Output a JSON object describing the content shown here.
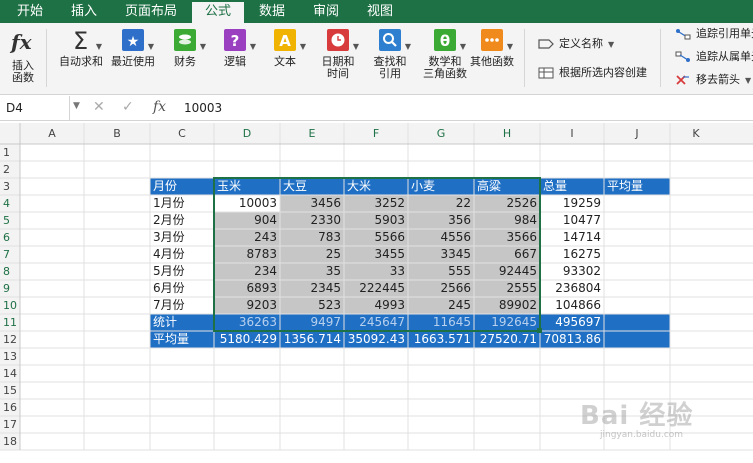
{
  "tabs": [
    {
      "label": "开始",
      "active": false
    },
    {
      "label": "插入",
      "active": false
    },
    {
      "label": "页面布局",
      "active": false
    },
    {
      "label": "公式",
      "active": true
    },
    {
      "label": "数据",
      "active": false
    },
    {
      "label": "审阅",
      "active": false
    },
    {
      "label": "视图",
      "active": false
    }
  ],
  "ribbon": {
    "insert_function": {
      "icon": "fx-icon",
      "label": "插入\n函数"
    },
    "buttons": [
      {
        "key": "autosum",
        "label": "自动求和",
        "icon": "sigma-icon",
        "color": "#333333"
      },
      {
        "key": "recent",
        "label": "最近使用",
        "icon": "star-icon",
        "color": "#2e6fc9"
      },
      {
        "key": "financial",
        "label": "财务",
        "icon": "coins-icon",
        "color": "#3aaa35"
      },
      {
        "key": "logical",
        "label": "逻辑",
        "icon": "question-icon",
        "color": "#9b3fc1"
      },
      {
        "key": "text",
        "label": "文本",
        "icon": "text-a-icon",
        "color": "#f0b400"
      },
      {
        "key": "datetime",
        "label": "日期和\n时间",
        "icon": "clock-icon",
        "color": "#d83b3b"
      },
      {
        "key": "lookup",
        "label": "查找和\n引用",
        "icon": "magnifier-icon",
        "color": "#2e7fd0"
      },
      {
        "key": "math",
        "label": "数学和\n三角函数",
        "icon": "theta-icon",
        "color": "#3aaa35"
      },
      {
        "key": "more",
        "label": "其他函数",
        "icon": "dots-icon",
        "color": "#f08a1c"
      }
    ],
    "names": {
      "define_name": "定义名称",
      "create_from_selection": "根据所选内容创建"
    },
    "audit": {
      "trace_precedents": "追踪引用单元",
      "trace_dependents": "追踪从属单元",
      "remove_arrows": "移去箭头"
    }
  },
  "formula_bar": {
    "name_box": "D4",
    "fx": "fx",
    "formula": "10003"
  },
  "sheet": {
    "columns": [
      "A",
      "B",
      "C",
      "D",
      "E",
      "F",
      "G",
      "H",
      "I",
      "J",
      "K"
    ],
    "rows": [
      "1",
      "2",
      "3",
      "4",
      "5",
      "6",
      "7",
      "8",
      "9",
      "10",
      "11",
      "12",
      "13",
      "14",
      "15",
      "16",
      "17",
      "18"
    ],
    "header_row": [
      "月份",
      "玉米",
      "大豆",
      "大米",
      "小麦",
      "高粱",
      "总量",
      "平均量"
    ],
    "data_rows": [
      {
        "label": "1月份",
        "values": [
          "10003",
          "3456",
          "3252",
          "22",
          "2526"
        ],
        "total": "19259"
      },
      {
        "label": "2月份",
        "values": [
          "904",
          "2330",
          "5903",
          "356",
          "984"
        ],
        "total": "10477"
      },
      {
        "label": "3月份",
        "values": [
          "243",
          "783",
          "5566",
          "4556",
          "3566"
        ],
        "total": "14714"
      },
      {
        "label": "4月份",
        "values": [
          "8783",
          "25",
          "3455",
          "3345",
          "667"
        ],
        "total": "16275"
      },
      {
        "label": "5月份",
        "values": [
          "234",
          "35",
          "33",
          "555",
          "92445"
        ],
        "total": "93302"
      },
      {
        "label": "6月份",
        "values": [
          "6893",
          "2345",
          "222445",
          "2566",
          "2555"
        ],
        "total": "236804"
      },
      {
        "label": "7月份",
        "values": [
          "9203",
          "523",
          "4993",
          "245",
          "89902"
        ],
        "total": "104866"
      }
    ],
    "stats_row": {
      "label": "统计",
      "values": [
        "36263",
        "9497",
        "245647",
        "11645",
        "192645"
      ],
      "total": "495697"
    },
    "avg_row": {
      "label": "平均量",
      "values": [
        "5180.429",
        "1356.714",
        "35092.43",
        "1663.571",
        "27520.71"
      ],
      "total": "70813.86"
    },
    "active_cell": "D4",
    "colors": {
      "header_fill": "#1f6fc4",
      "selection_fill": "#c6c6c6",
      "selection_border": "#1e7145",
      "grid_line": "#e1e1e1"
    }
  },
  "watermark": {
    "main": "Bai 经验",
    "sub": "jingyan.baidu.com"
  }
}
